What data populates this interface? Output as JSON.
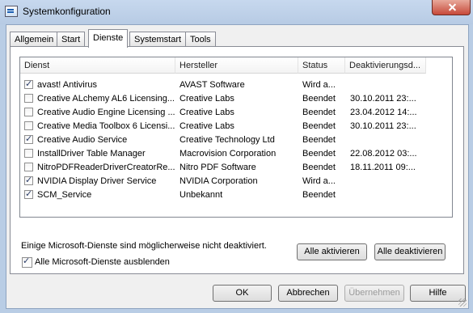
{
  "window": {
    "title": "Systemkonfiguration"
  },
  "tabs": [
    {
      "label": "Allgemein"
    },
    {
      "label": "Start"
    },
    {
      "label": "Dienste"
    },
    {
      "label": "Systemstart"
    },
    {
      "label": "Tools"
    }
  ],
  "active_tab": "Dienste",
  "services": {
    "columns": [
      "Dienst",
      "Hersteller",
      "Status",
      "Deaktivierungsd..."
    ],
    "rows": [
      {
        "checked": true,
        "name": "avast! Antivirus",
        "vendor": "AVAST Software",
        "status": "Wird a...",
        "date": ""
      },
      {
        "checked": false,
        "name": "Creative ALchemy AL6 Licensing...",
        "vendor": "Creative Labs",
        "status": "Beendet",
        "date": "30.10.2011 23:..."
      },
      {
        "checked": false,
        "name": "Creative Audio Engine Licensing ...",
        "vendor": "Creative Labs",
        "status": "Beendet",
        "date": "23.04.2012 14:..."
      },
      {
        "checked": false,
        "name": "Creative Media Toolbox 6 Licensi...",
        "vendor": "Creative Labs",
        "status": "Beendet",
        "date": "30.10.2011 23:..."
      },
      {
        "checked": true,
        "name": "Creative Audio Service",
        "vendor": "Creative Technology Ltd",
        "status": "Beendet",
        "date": ""
      },
      {
        "checked": false,
        "name": "InstallDriver Table Manager",
        "vendor": "Macrovision Corporation",
        "status": "Beendet",
        "date": "22.08.2012 03:..."
      },
      {
        "checked": false,
        "name": "NitroPDFReaderDriverCreatorRe...",
        "vendor": "Nitro PDF Software",
        "status": "Beendet",
        "date": "18.11.2011 09:..."
      },
      {
        "checked": true,
        "name": "NVIDIA Display Driver Service",
        "vendor": "NVIDIA Corporation",
        "status": "Wird a...",
        "date": ""
      },
      {
        "checked": true,
        "name": "SCM_Service",
        "vendor": "Unbekannt",
        "status": "Beendet",
        "date": ""
      }
    ]
  },
  "note": "Einige Microsoft-Dienste sind möglicherweise nicht deaktiviert.",
  "buttons": {
    "enable_all": "Alle aktivieren",
    "disable_all": "Alle deaktivieren",
    "ok": "OK",
    "cancel": "Abbrechen",
    "apply": "Übernehmen",
    "help": "Hilfe"
  },
  "hide_ms": {
    "label": "Alle Microsoft-Dienste ausblenden",
    "checked": true
  }
}
